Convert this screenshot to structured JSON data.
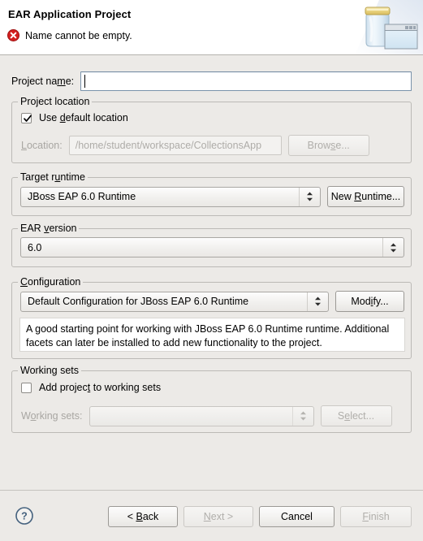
{
  "window": {
    "title": "EAR Application Project"
  },
  "header": {
    "title": "EAR Application Project",
    "error_icon": "error-circle-icon",
    "error_message": "Name cannot be empty.",
    "art_icon": "jar-archive-icon",
    "error_color": "#d32020"
  },
  "project_name": {
    "label_pre": "Project na",
    "label_mnemonic": "m",
    "label_post": "e:",
    "value": "",
    "focused": true
  },
  "project_location": {
    "group_label": "Project location",
    "use_default": {
      "label_pre": "Use ",
      "label_mnemonic": "d",
      "label_post": "efault location",
      "checked": true
    },
    "location": {
      "label_mnemonic": "L",
      "label_post": "ocation:",
      "value": "/home/student/workspace/CollectionsApp",
      "enabled": false
    },
    "browse_button": {
      "label_pre": "Brow",
      "label_mnemonic": "s",
      "label_post": "e...",
      "enabled": false
    }
  },
  "target_runtime": {
    "group_label_pre": "Target r",
    "group_label_mnemonic": "u",
    "group_label_post": "ntime",
    "selected": "JBoss EAP 6.0 Runtime",
    "new_runtime_button": {
      "label_pre": "New ",
      "label_mnemonic": "R",
      "label_post": "untime...",
      "enabled": true
    }
  },
  "ear_version": {
    "group_label_pre": "EAR ",
    "group_label_mnemonic": "v",
    "group_label_post": "ersion",
    "selected": "6.0"
  },
  "configuration": {
    "group_label_mnemonic": "C",
    "group_label_post": "onfiguration",
    "selected": "Default Configuration for JBoss EAP 6.0 Runtime",
    "modify_button": {
      "label_pre": "Mod",
      "label_mnemonic": "i",
      "label_post": "fy...",
      "enabled": true
    },
    "description": "A good starting point for working with JBoss EAP 6.0 Runtime runtime. Additional facets can later be installed to add new functionality to the project."
  },
  "working_sets": {
    "group_label": "Working sets",
    "add_project": {
      "label_pre": "Add projec",
      "label_mnemonic": "t",
      "label_post": " to working sets",
      "checked": false
    },
    "working_sets_field": {
      "label_pre": "W",
      "label_mnemonic": "o",
      "label_post": "rking sets:",
      "value": "",
      "enabled": false
    },
    "select_button": {
      "label_pre": "S",
      "label_mnemonic": "e",
      "label_post": "lect...",
      "enabled": false
    }
  },
  "footer": {
    "help_icon": "help-question-icon",
    "buttons": [
      {
        "name": "back",
        "label_pre": "< ",
        "label_mnemonic": "B",
        "label_post": "ack",
        "enabled": true
      },
      {
        "name": "next",
        "label_pre": "",
        "label_mnemonic": "N",
        "label_post": "ext >",
        "enabled": false
      },
      {
        "name": "cancel",
        "label_pre": "Cancel",
        "label_mnemonic": "",
        "label_post": "",
        "enabled": true
      },
      {
        "name": "finish",
        "label_pre": "",
        "label_mnemonic": "F",
        "label_post": "inish",
        "enabled": false
      }
    ]
  }
}
